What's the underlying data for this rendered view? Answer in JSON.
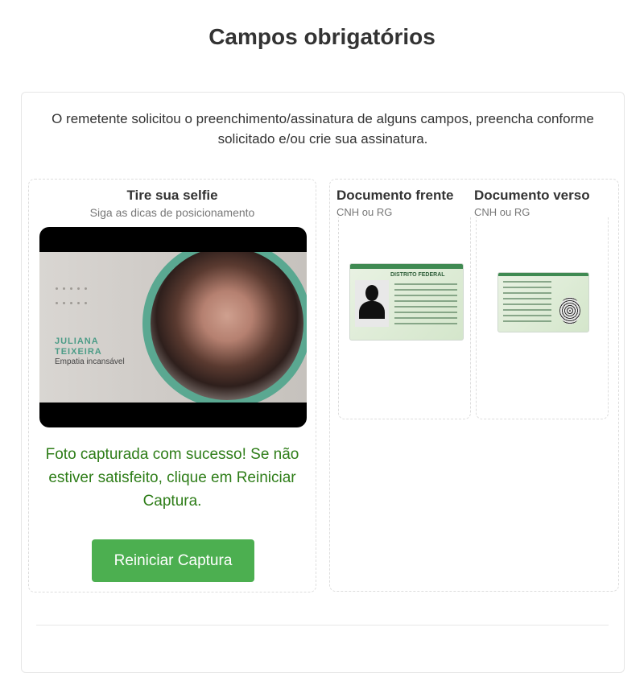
{
  "header": {
    "title": "Campos obrigatórios"
  },
  "intro": {
    "text": "O remetente solicitou o preenchimento/assinatura de alguns campos, preencha conforme solicitado e/ou crie sua assinatura."
  },
  "selfie": {
    "title": "Tire sua selfie",
    "subtitle": "Siga as dicas de posicionamento",
    "badge_name": "JULIANA TEIXEIRA",
    "badge_role": "Empatia incansável",
    "success_message": "Foto capturada com sucesso! Se não estiver satisfeito, clique em Reiniciar Captura.",
    "restart_label": "Reiniciar Captura"
  },
  "documents": [
    {
      "title": "Documento frente",
      "subtitle": "CNH ou RG",
      "header_text": "DISTRITO FEDERAL"
    },
    {
      "title": "Documento verso",
      "subtitle": "CNH ou RG"
    }
  ],
  "colors": {
    "success": "#2e7d18",
    "button": "#4caf50",
    "accent_ring": "#5aa891"
  }
}
